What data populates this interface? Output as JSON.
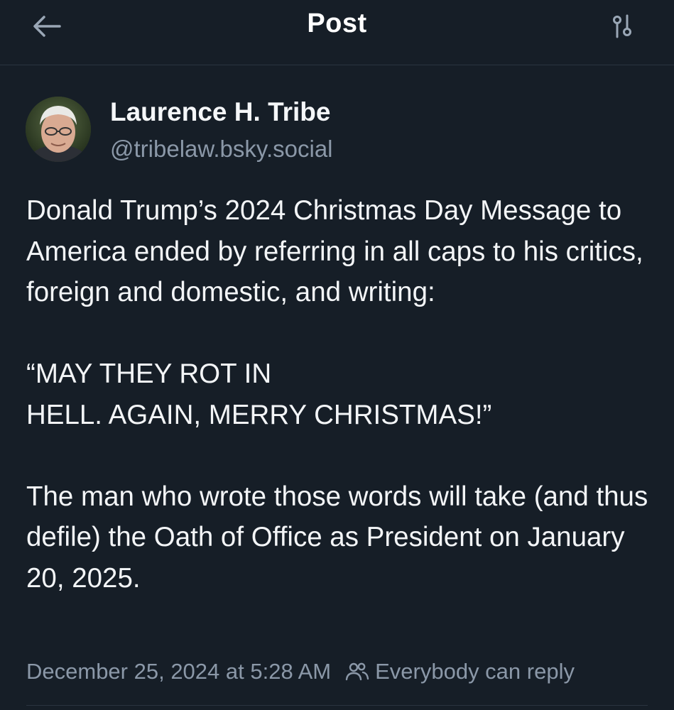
{
  "header": {
    "title": "Post"
  },
  "author": {
    "display_name": "Laurence H. Tribe",
    "handle": "@tribelaw.bsky.social"
  },
  "post": {
    "paragraphs": [
      "Donald Trump’s 2024 Christmas Day Message to America ended by referring in all caps to his critics, foreign and domestic, and writing:",
      "“MAY THEY ROT IN\nHELL. AGAIN, MERRY CHRISTMAS!”",
      "The man who wrote those words will take (and thus defile) the Oath of Office as President on January 20, 2025."
    ],
    "timestamp": "December 25, 2024 at 5:28 AM",
    "reply_setting": "Everybody can reply"
  },
  "icons": {
    "back": "arrow-left-icon",
    "settings": "sliders-icon",
    "reply": "people-icon"
  },
  "colors": {
    "background": "#161e27",
    "text": "#f3f5f7",
    "muted": "#8b98a8",
    "divider": "#2a3440"
  }
}
